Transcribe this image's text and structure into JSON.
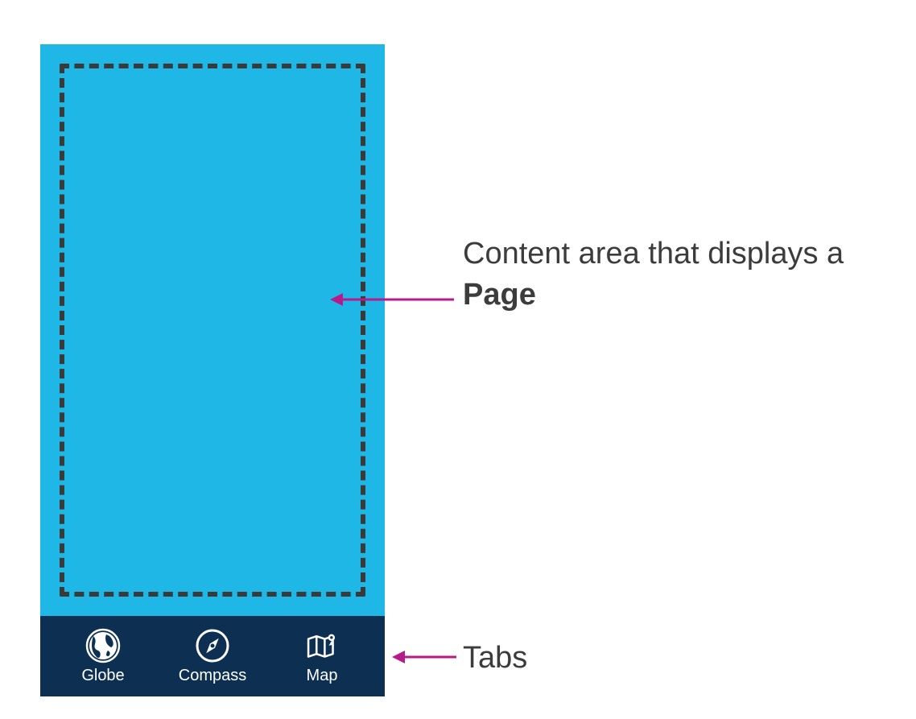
{
  "tabs": {
    "items": [
      {
        "label": "Globe",
        "icon": "globe-icon"
      },
      {
        "label": "Compass",
        "icon": "compass-icon"
      },
      {
        "label": "Map",
        "icon": "map-icon"
      }
    ]
  },
  "annotations": {
    "content_area_prefix": "Content area that displays a ",
    "content_area_bold": "Page",
    "tabs_label": "Tabs"
  },
  "colors": {
    "content_bg": "#1eb7e6",
    "tab_bg": "#0c2f52",
    "dashed_border": "#3a3a3a",
    "arrow": "#b81a8c",
    "annotation_text": "#3c3c3c"
  }
}
